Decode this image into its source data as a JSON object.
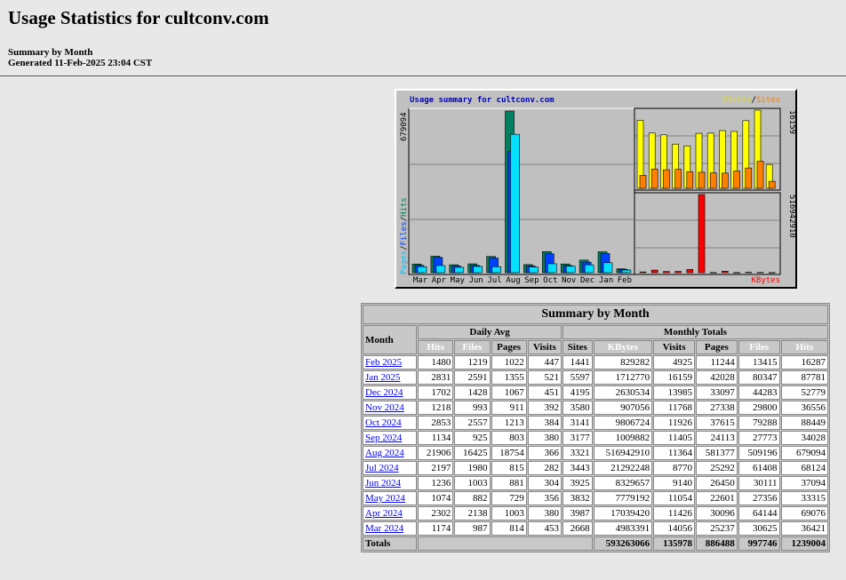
{
  "page": {
    "title": "Usage Statistics for cultconv.com",
    "subtitle": "Summary by Month",
    "generated": "Generated 11-Feb-2025 23:04 CST"
  },
  "colors": {
    "hits": "#00805c",
    "files": "#0040ff",
    "pages": "#00e0ff",
    "visits": "#ffff00",
    "sites": "#ff8000",
    "kbytes": "#ff0000"
  },
  "graph": {
    "title": "Usage summary for cultconv.com",
    "legend_visits": "Visits",
    "legend_sep": "/",
    "legend_sites": "Sites",
    "left_axis_pages": "Pages",
    "left_axis_files": "Files",
    "left_axis_hits": "Hits",
    "left_max": "679094",
    "right_top_max": "16159",
    "right_bottom_max": "516942910",
    "kbytes_label": "KBytes",
    "months": [
      "Mar",
      "Apr",
      "May",
      "Jun",
      "Jul",
      "Aug",
      "Sep",
      "Oct",
      "Nov",
      "Dec",
      "Jan",
      "Feb"
    ]
  },
  "chart_data": {
    "type": "bar",
    "title": "Usage summary for cultconv.com",
    "categories": [
      "Mar",
      "Apr",
      "May",
      "Jun",
      "Jul",
      "Aug",
      "Sep",
      "Oct",
      "Nov",
      "Dec",
      "Jan",
      "Feb"
    ],
    "series": [
      {
        "name": "Hits",
        "values": [
          36421,
          69076,
          33315,
          37094,
          68124,
          679094,
          34028,
          88449,
          36556,
          52779,
          87781,
          16287
        ]
      },
      {
        "name": "Files",
        "values": [
          30625,
          64144,
          27356,
          30111,
          61408,
          509196,
          27773,
          79288,
          29800,
          44283,
          80347,
          13415
        ]
      },
      {
        "name": "Pages",
        "values": [
          25237,
          30096,
          22601,
          26450,
          25292,
          581377,
          24113,
          37615,
          27338,
          33097,
          42028,
          11244
        ]
      },
      {
        "name": "Visits",
        "values": [
          14056,
          11426,
          11054,
          9140,
          8770,
          11364,
          11405,
          11926,
          11768,
          13985,
          16159,
          4925
        ]
      },
      {
        "name": "Sites",
        "values": [
          2668,
          3987,
          3832,
          3925,
          3443,
          3321,
          3177,
          3141,
          3580,
          4195,
          5597,
          1441
        ]
      },
      {
        "name": "KBytes",
        "values": [
          4983391,
          17039420,
          7779192,
          8329657,
          21292248,
          516942910,
          1009882,
          9806724,
          907056,
          2630534,
          1712770,
          829282
        ]
      }
    ]
  },
  "table": {
    "title": "Summary by Month",
    "month_label": "Month",
    "daily_avg_label": "Daily Avg",
    "monthly_totals_label": "Monthly Totals",
    "col_hits": "Hits",
    "col_files": "Files",
    "col_pages": "Pages",
    "col_visits": "Visits",
    "col_sites": "Sites",
    "col_kbytes": "KBytes",
    "rows": [
      {
        "month": "Feb 2025",
        "hits": "1480",
        "files": "1219",
        "pages": "1022",
        "visits": "447",
        "sites": "1441",
        "kbytes": "829282",
        "tvisits": "4925",
        "tpages": "11244",
        "tfiles": "13415",
        "thits": "16287"
      },
      {
        "month": "Jan 2025",
        "hits": "2831",
        "files": "2591",
        "pages": "1355",
        "visits": "521",
        "sites": "5597",
        "kbytes": "1712770",
        "tvisits": "16159",
        "tpages": "42028",
        "tfiles": "80347",
        "thits": "87781"
      },
      {
        "month": "Dec 2024",
        "hits": "1702",
        "files": "1428",
        "pages": "1067",
        "visits": "451",
        "sites": "4195",
        "kbytes": "2630534",
        "tvisits": "13985",
        "tpages": "33097",
        "tfiles": "44283",
        "thits": "52779"
      },
      {
        "month": "Nov 2024",
        "hits": "1218",
        "files": "993",
        "pages": "911",
        "visits": "392",
        "sites": "3580",
        "kbytes": "907056",
        "tvisits": "11768",
        "tpages": "27338",
        "tfiles": "29800",
        "thits": "36556"
      },
      {
        "month": "Oct 2024",
        "hits": "2853",
        "files": "2557",
        "pages": "1213",
        "visits": "384",
        "sites": "3141",
        "kbytes": "9806724",
        "tvisits": "11926",
        "tpages": "37615",
        "tfiles": "79288",
        "thits": "88449"
      },
      {
        "month": "Sep 2024",
        "hits": "1134",
        "files": "925",
        "pages": "803",
        "visits": "380",
        "sites": "3177",
        "kbytes": "1009882",
        "tvisits": "11405",
        "tpages": "24113",
        "tfiles": "27773",
        "thits": "34028"
      },
      {
        "month": "Aug 2024",
        "hits": "21906",
        "files": "16425",
        "pages": "18754",
        "visits": "366",
        "sites": "3321",
        "kbytes": "516942910",
        "tvisits": "11364",
        "tpages": "581377",
        "tfiles": "509196",
        "thits": "679094"
      },
      {
        "month": "Jul 2024",
        "hits": "2197",
        "files": "1980",
        "pages": "815",
        "visits": "282",
        "sites": "3443",
        "kbytes": "21292248",
        "tvisits": "8770",
        "tpages": "25292",
        "tfiles": "61408",
        "thits": "68124"
      },
      {
        "month": "Jun 2024",
        "hits": "1236",
        "files": "1003",
        "pages": "881",
        "visits": "304",
        "sites": "3925",
        "kbytes": "8329657",
        "tvisits": "9140",
        "tpages": "26450",
        "tfiles": "30111",
        "thits": "37094"
      },
      {
        "month": "May 2024",
        "hits": "1074",
        "files": "882",
        "pages": "729",
        "visits": "356",
        "sites": "3832",
        "kbytes": "7779192",
        "tvisits": "11054",
        "tpages": "22601",
        "tfiles": "27356",
        "thits": "33315"
      },
      {
        "month": "Apr 2024",
        "hits": "2302",
        "files": "2138",
        "pages": "1003",
        "visits": "380",
        "sites": "3987",
        "kbytes": "17039420",
        "tvisits": "11426",
        "tpages": "30096",
        "tfiles": "64144",
        "thits": "69076"
      },
      {
        "month": "Mar 2024",
        "hits": "1174",
        "files": "987",
        "pages": "814",
        "visits": "453",
        "sites": "2668",
        "kbytes": "4983391",
        "tvisits": "14056",
        "tpages": "25237",
        "tfiles": "30625",
        "thits": "36421"
      }
    ],
    "totals": {
      "label": "Totals",
      "kbytes": "593263066",
      "visits": "135978",
      "pages": "886488",
      "files": "997746",
      "hits": "1239004"
    }
  }
}
